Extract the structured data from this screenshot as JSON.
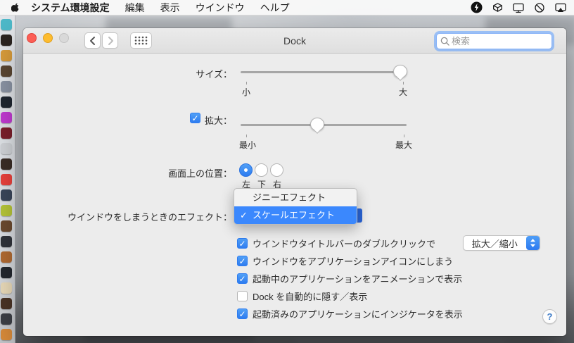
{
  "menubar": {
    "items": [
      "システム環境設定",
      "編集",
      "表示",
      "ウインドウ",
      "ヘルプ"
    ],
    "status_icons": [
      "power-bolt-icon",
      "dropbox-icon",
      "display-icon",
      "do-not-disturb-icon",
      "airplay-display-icon"
    ]
  },
  "window": {
    "title": "Dock",
    "search": {
      "placeholder": "検索"
    }
  },
  "panel": {
    "size": {
      "label": "サイズ：",
      "min_label": "小",
      "max_label": "大",
      "value_percent": 96
    },
    "magnification": {
      "label": "拡大：",
      "checked": true,
      "check_glyph": "✓",
      "min_label": "最小",
      "max_label": "最大",
      "value_percent": 46
    },
    "position": {
      "label": "画面上の位置：",
      "options": [
        "左",
        "下",
        "右"
      ],
      "selected": "左",
      "selected_flags": [
        true,
        false,
        false
      ]
    },
    "effect": {
      "label": "ウインドウをしまうときのエフェクト：",
      "menu_items": [
        {
          "label": "ジニーエフェクト",
          "checked": false,
          "check_glyph": ""
        },
        {
          "label": "スケールエフェクト",
          "checked": true,
          "check_glyph": "✓"
        }
      ]
    },
    "checkboxes": [
      {
        "label": "ウインドウタイトルバーのダブルクリックで",
        "checked": true,
        "check_glyph": "✓",
        "popup_value": "拡大／縮小"
      },
      {
        "label": "ウインドウをアプリケーションアイコンにしまう",
        "checked": true,
        "check_glyph": "✓"
      },
      {
        "label": "起動中のアプリケーションをアニメーションで表示",
        "checked": true,
        "check_glyph": "✓"
      },
      {
        "label": "Dock を自動的に隠す／表示",
        "checked": false,
        "check_glyph": ""
      },
      {
        "label": "起動済みのアプリケーションにインジケータを表示",
        "checked": true,
        "check_glyph": "✓"
      }
    ],
    "help_label": "?"
  },
  "dock": {
    "icon_colors": [
      "#4db8c8",
      "#2a2320",
      "#d79b3a",
      "#5a4632",
      "#8a93a3",
      "#1f2630",
      "#c03ad0",
      "#7a1f2b",
      "#cfd2d6",
      "#3a2d26",
      "#e8413c",
      "#39465a",
      "#b5c437",
      "#6b4a2f",
      "#30333a",
      "#b06a32",
      "#23272e",
      "#e8d9b8",
      "#4a3426",
      "#3c3f46",
      "#d78a3a"
    ]
  },
  "colors": {
    "selection_blue": "#3b88fd",
    "control_blue": "#2e7cf0",
    "traffic_red": "#fc5e55",
    "traffic_yellow": "#fdbc2e",
    "traffic_disabled": "#d9d9d9",
    "window_bg": "#ececec"
  }
}
